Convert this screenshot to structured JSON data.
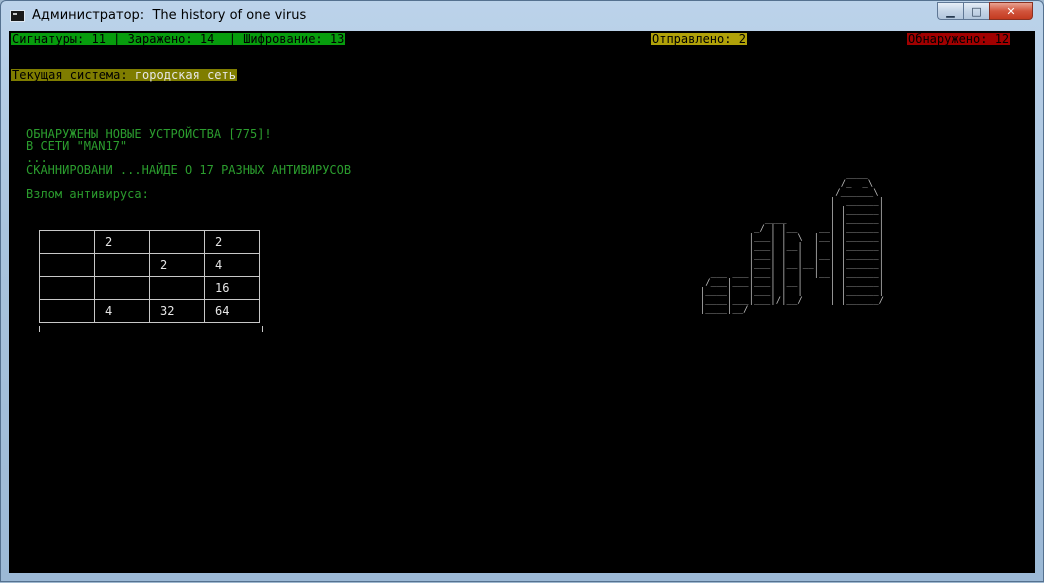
{
  "window": {
    "title": "Администратор:  The history of one virus",
    "minimize_glyph": "▁",
    "maximize_glyph": "□",
    "close_glyph": "✕"
  },
  "stats": {
    "left": "Сигнатуры: 11 | Заражено: 14  | Шифрование: 13",
    "sent": "Отправлено: 2",
    "found": "Обнаружено: 12"
  },
  "system": {
    "label": "Текущая система:",
    "value": "городская сеть"
  },
  "log": [
    "ОБНАРУЖЕНЫ НОВЫЕ УСТРОЙСТВА [775]!",
    "В СЕТИ \"MAN17\"",
    "...",
    "СКАННИРОВАНИ ...НАЙДЕ О 17 РАЗНЫХ АНТИВИРУСОВ"
  ],
  "hack_label": "Взлом антивируса:",
  "grid_rows": [
    [
      "",
      "2",
      "",
      "2"
    ],
    [
      "",
      "",
      "2",
      "4"
    ],
    [
      "",
      "",
      "",
      "16"
    ],
    [
      "",
      "4",
      "32",
      "64"
    ]
  ],
  "ascii_art": "                             ____\n                            /_  _\\\n                           /______\\\n                          |  ______|\n                          | |______|\n              ____        | |______|\n            _/ | |__    __| |______|\n           |___| |  \\  |__| |______|\n           |___| |__|  |  | |______|\n           |___| |  |  |__| |______|\n           |___| |__|__|  | |______|\n    ___ ___|___| |  |  |__| |______|\n   /___|___|___| |__|     | |______|\n  |____|   |___| |  |     | |______|\n  |____|___|___|/|__/     | |______/\n  |____|__/\n",
  "colors": {
    "stat_green": "#079c0d",
    "stat_yellow": "#b0a109",
    "stat_red": "#a10000",
    "system_bg": "#7f7d00",
    "log_green": "#2b9d2e",
    "console_bg": "#000000"
  }
}
